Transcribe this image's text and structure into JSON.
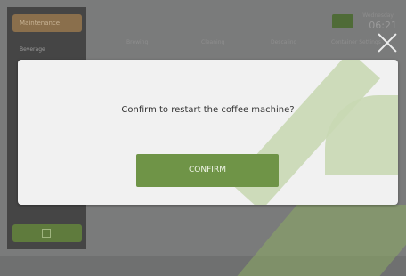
{
  "sidebar": {
    "top_button": "Maintenance",
    "item": "Beverage"
  },
  "topbar": {
    "tabs": [
      "Brewing",
      "Cleaning",
      "Descaling",
      "Container Settings"
    ],
    "clock_label": "Wednesday",
    "clock": "06:21"
  },
  "dialog": {
    "message": "Confirm to restart the coffee machine?",
    "confirm_label": "CONFIRM"
  },
  "colors": {
    "accent": "#6f9447",
    "dialog_bg": "#f1f1f1",
    "overlay": "#7a7b7b"
  }
}
